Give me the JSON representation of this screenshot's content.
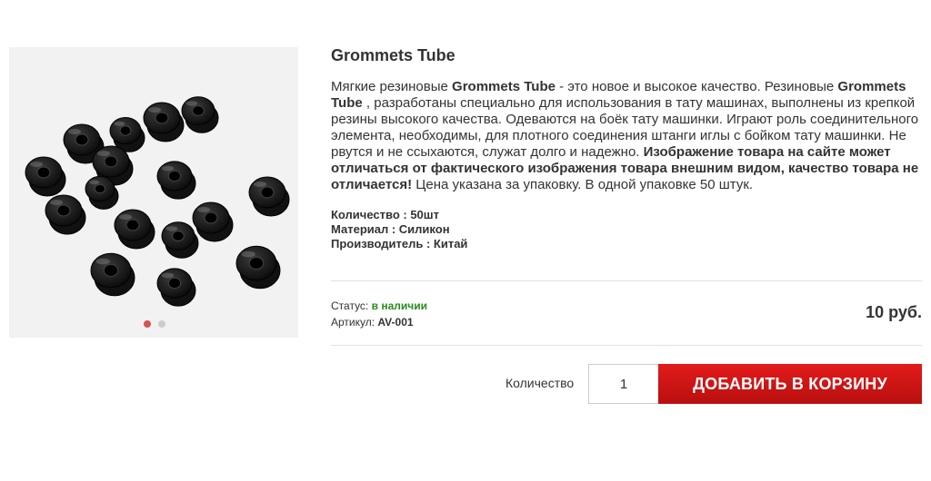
{
  "product": {
    "title": "Grommets Tube",
    "image_alt": "Grommets Tube",
    "description": {
      "p1": "Мягкие резиновые ",
      "b1": "Grommets Tube",
      "p2": " - это новое и высокое качество. Резиновые ",
      "b2": "Grommets Tube",
      "p3": " , разработаны специально для использования в тату машинах, выполнены из крепкой резины высокого качества. Одеваются на боёк тату машинки. Играют роль соединительного элемента, необходимы, для плотного соединения штанги иглы с бойком тату машинки. Не рвутся и не ссыхаются, служат долго и надежно. ",
      "b3": "Изображение товара на сайте может отличаться от фактического изображения товара внешним видом, качество товара не отличается!",
      "p4": " Цена указана за упаковку. В одной упаковке 50 штук."
    },
    "properties": [
      "Количество : 50шт",
      "Материал : Силикон",
      "Производитель : Китай"
    ],
    "status_label": "Статус: ",
    "status_value": "в наличии",
    "sku_label": "Артикул: ",
    "sku_value": "AV-001",
    "price": "10 руб."
  },
  "cart": {
    "quantity_label": "Количество",
    "quantity_value": "1",
    "add_button": "ДОБАВИТЬ В КОРЗИНУ"
  },
  "gallery": {
    "slides_count": 2,
    "active_slide": 1
  },
  "colors": {
    "accent": "#d9534f",
    "button": "#d01515",
    "in_stock": "#2a8a1f"
  }
}
